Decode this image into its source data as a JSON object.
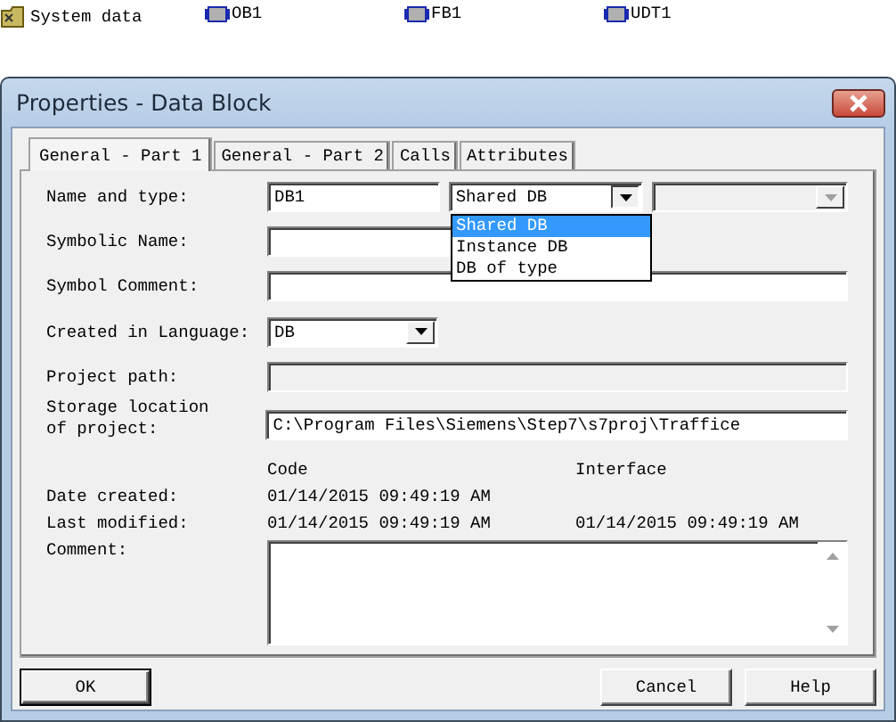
{
  "desktop_items": [
    {
      "kind": "folder",
      "label": "System data"
    },
    {
      "kind": "block",
      "label": "OB1"
    },
    {
      "kind": "block",
      "label": "FB1"
    },
    {
      "kind": "block",
      "label": "UDT1"
    }
  ],
  "window": {
    "title": "Properties - Data Block"
  },
  "tabs": [
    {
      "label": "General - Part 1",
      "selected": true
    },
    {
      "label": "General - Part 2",
      "selected": false
    },
    {
      "label": "Calls",
      "selected": false
    },
    {
      "label": "Attributes",
      "selected": false
    }
  ],
  "form": {
    "name_and_type": {
      "label": "Name and type:",
      "name_value": "DB1",
      "type_dropdown": {
        "value": "Shared DB",
        "expanded": true,
        "options": [
          {
            "label": "Shared DB",
            "selected": true
          },
          {
            "label": "Instance DB",
            "selected": false
          },
          {
            "label": "DB of type",
            "selected": false
          }
        ]
      },
      "extra_dropdown": {
        "disabled": true
      }
    },
    "symbolic_name": {
      "label": "Symbolic Name:"
    },
    "symbol_comment": {
      "label": "Symbol Comment:"
    },
    "created_in_language": {
      "label": "Created in Language:",
      "value": "DB"
    },
    "project_path": {
      "label": "Project path:",
      "disabled": true
    },
    "storage_location": {
      "label": "Storage location of project:",
      "value": "C:\\Program Files\\Siemens\\Step7\\s7proj\\Traffice"
    },
    "dates": {
      "columns": [
        "Code",
        "Interface"
      ],
      "rows": [
        {
          "label": "Date created:",
          "code": "01/14/2015 09:49:19 AM"
        },
        {
          "label": "Last modified:",
          "code": "01/14/2015 09:49:19 AM",
          "interface": "01/14/2015 09:49:19 AM"
        }
      ]
    },
    "comment": {
      "label": "Comment:"
    }
  },
  "buttons_left": [
    {
      "label": "OK",
      "default": true
    }
  ],
  "buttons_right": [
    {
      "label": "Cancel",
      "default": false
    },
    {
      "label": "Help",
      "default": false
    }
  ]
}
